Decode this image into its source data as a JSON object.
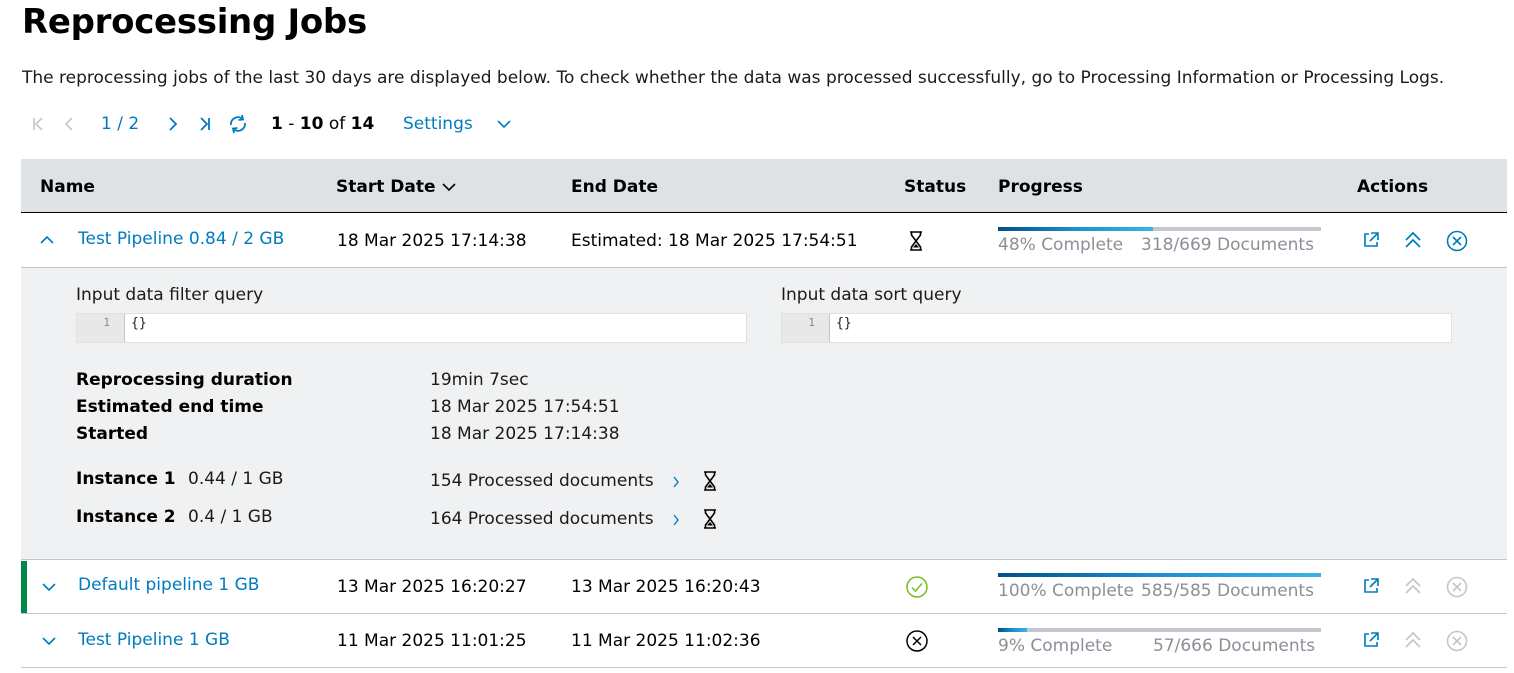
{
  "page": {
    "title": "Reprocessing Jobs",
    "description": "The reprocessing jobs of the last 30 days are displayed below. To check whether the data was processed successfully, go to Processing Information or Processing Logs."
  },
  "pager": {
    "page_indicator": "1 / 2",
    "range_start": "1",
    "range_sep": " - ",
    "range_end": "10",
    "of_label": " of ",
    "total": "14",
    "settings_label": "Settings"
  },
  "table": {
    "columns": {
      "name": "Name",
      "start_date": "Start Date",
      "end_date": "End Date",
      "status": "Status",
      "progress": "Progress",
      "actions": "Actions"
    },
    "rows": [
      {
        "name": "Test Pipeline 0.84 / 2 GB",
        "start": "18 Mar 2025 17:14:38",
        "end": "Estimated: 18 Mar 2025 17:54:51",
        "status_icon": "hourglass-icon",
        "progress_fraction": 0.48,
        "progress_label": "48% Complete",
        "documents_label": "318/669 Documents",
        "expanded": true
      },
      {
        "name": "Default pipeline 1 GB",
        "start": "13 Mar 2025 16:20:27",
        "end": "13 Mar 2025 16:20:43",
        "status_icon": "check-circle-icon",
        "progress_fraction": 1.0,
        "progress_label": "100% Complete",
        "documents_label": "585/585 Documents",
        "expanded": false
      },
      {
        "name": "Test Pipeline 1 GB",
        "start": "11 Mar 2025 11:01:25",
        "end": "11 Mar 2025 11:02:36",
        "status_icon": "cancel-circle-icon",
        "progress_fraction": 0.09,
        "progress_label": "9% Complete",
        "documents_label": "57/666 Documents",
        "expanded": false
      }
    ]
  },
  "details": {
    "filter_label": "Input data filter query",
    "filter_line_no": "1",
    "filter_value": "{}",
    "sort_label": "Input data sort query",
    "sort_line_no": "1",
    "sort_value": "{}",
    "duration_label": "Reprocessing duration",
    "duration_value": "19min 7sec",
    "est_end_label": "Estimated end time",
    "est_end_value": "18 Mar 2025 17:54:51",
    "started_label": "Started",
    "started_value": "18 Mar 2025 17:14:38",
    "instances": [
      {
        "label": "Instance 1",
        "size": "0.44 / 1 GB",
        "processed": "154 Processed documents"
      },
      {
        "label": "Instance 2",
        "size": "0.4 / 1 GB",
        "processed": "164 Processed documents"
      }
    ]
  },
  "colors": {
    "accent": "#007bc0",
    "success": "#78be20",
    "success_bar": "#00884a",
    "header_bg": "#dfe2e5",
    "detail_bg": "#eff1f2"
  }
}
